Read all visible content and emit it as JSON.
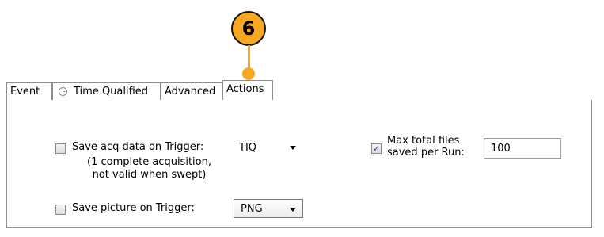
{
  "callout": {
    "number": "6",
    "color": "#f7a823"
  },
  "tabs": [
    {
      "label": "Event"
    },
    {
      "label": "Time Qualified"
    },
    {
      "label": "Advanced"
    },
    {
      "label": "Actions"
    }
  ],
  "actions": {
    "save_acq": {
      "label": "Save acq data on Trigger:",
      "checked": false,
      "format": "TIQ",
      "note_line1": "(1 complete acquisition,",
      "note_line2": "not valid when swept)"
    },
    "save_picture": {
      "label": "Save picture on Trigger:",
      "checked": false,
      "format": "PNG"
    },
    "max_files": {
      "label_line1": "Max total files",
      "label_line2": "saved per Run:",
      "checked": true,
      "value": "100"
    }
  }
}
